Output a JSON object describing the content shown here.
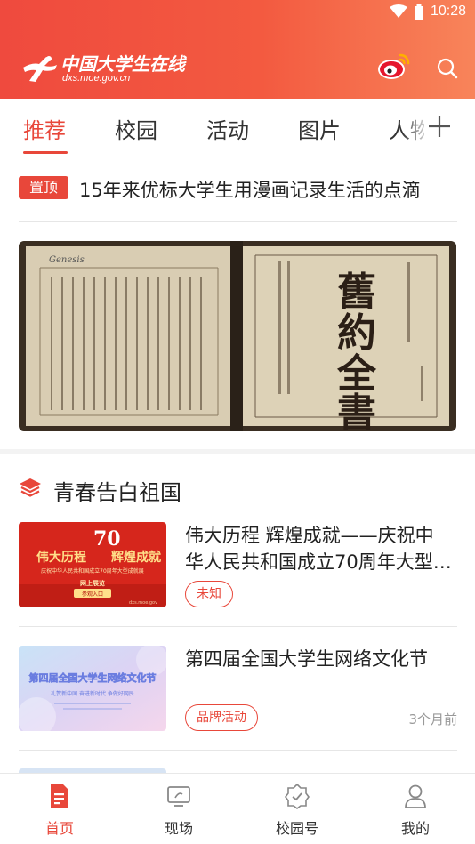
{
  "status_bar": {
    "time": "10:28"
  },
  "header": {
    "logo_name": "中国大学生在线",
    "logo_url": "dxs.moe.gov.cn"
  },
  "tabs": [
    {
      "label": "推荐",
      "active": true
    },
    {
      "label": "校园"
    },
    {
      "label": "活动"
    },
    {
      "label": "图片"
    },
    {
      "label": "人物"
    }
  ],
  "pinned": {
    "badge": "置顶",
    "title": "15年来优标大学生用漫画记录生活的点滴"
  },
  "banner": {
    "book_title_chars": [
      "舊",
      "約",
      "全",
      "書"
    ],
    "page_heading": "Genesis"
  },
  "section": {
    "title": "青春告白祖国"
  },
  "articles": [
    {
      "title": "伟大历程 辉煌成就——庆祝中华人民共和国成立70周年大型成就展网上展览",
      "tag": "未知",
      "time": "",
      "thumb": {
        "line1": "伟大历程",
        "line2": "辉煌成就",
        "subtitle": "庆祝中华人民共和国成立70周年大型成就展",
        "online": "网上展览",
        "entry": "参观入口",
        "emblem": "70",
        "credit": "dxs.moe.gov"
      }
    },
    {
      "title": "第四届全国大学生网络文化节",
      "tag": "品牌活动",
      "time": "3个月前",
      "thumb": {
        "headline": "第四届全国大学生网络文化节",
        "slogan": "礼赞新中国  奋进新时代  争做好网民"
      }
    }
  ],
  "bottom_nav": [
    {
      "label": "首页",
      "icon": "home-doc-icon",
      "active": true
    },
    {
      "label": "现场",
      "icon": "live-screen-icon"
    },
    {
      "label": "校园号",
      "icon": "campus-badge-icon"
    },
    {
      "label": "我的",
      "icon": "profile-icon"
    }
  ],
  "colors": {
    "accent": "#e8473a",
    "header_start": "#ef4a3e",
    "header_end": "#f8845a"
  }
}
